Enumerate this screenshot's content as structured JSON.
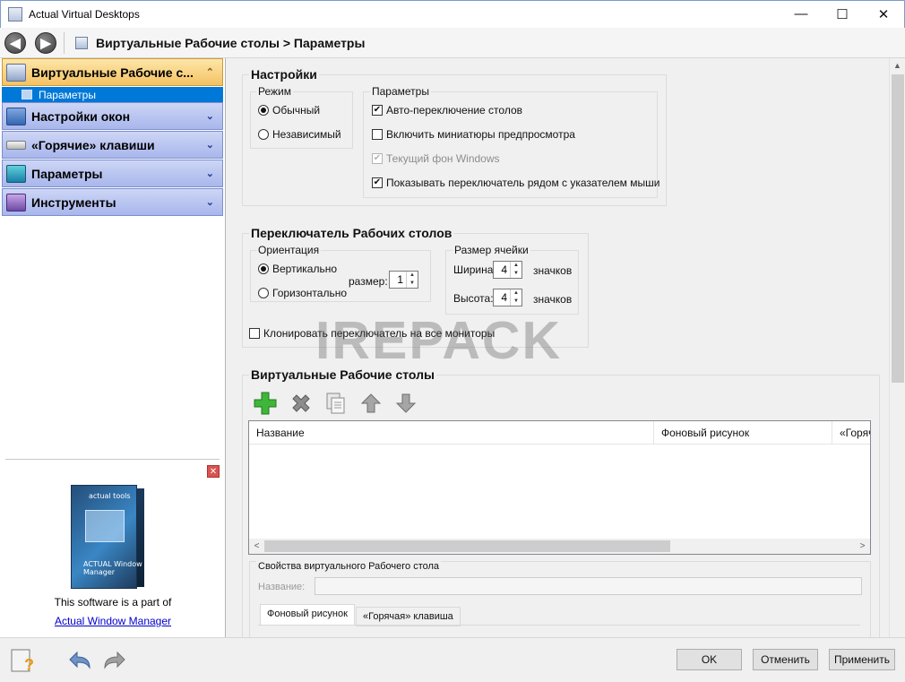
{
  "window": {
    "title": "Actual Virtual Desktops",
    "controls": {
      "minimize": "—",
      "maximize": "☐",
      "close": "✕"
    }
  },
  "nav": {
    "back": "◀",
    "forward": "▶",
    "breadcrumb": "Виртуальные Рабочие столы > Параметры"
  },
  "sidebar": {
    "sections": [
      {
        "label": "Виртуальные Рабочие с...",
        "chevron": "⌃",
        "active": true
      },
      {
        "label": "Настройки окон",
        "chevron": "⌄"
      },
      {
        "label": "«Горячие» клавиши",
        "chevron": "⌄"
      },
      {
        "label": "Параметры",
        "chevron": "⌄"
      },
      {
        "label": "Инструменты",
        "chevron": "⌄"
      }
    ],
    "sub_item": "Параметры",
    "promo": {
      "close": "✕",
      "box_brand": "actual tools",
      "box_product": "ACTUAL Window Manager",
      "text": "This software is a part of",
      "link": "Actual Window Manager"
    }
  },
  "settings": {
    "title": "Настройки",
    "mode": {
      "legend": "Режим",
      "options": [
        "Обычный",
        "Независимый"
      ],
      "selected": 0
    },
    "params": {
      "legend": "Параметры",
      "items": [
        {
          "label": "Авто-переключение столов",
          "checked": true,
          "disabled": false
        },
        {
          "label": "Включить миниатюры предпросмотра",
          "checked": false,
          "disabled": false
        },
        {
          "label": "Текущий фон Windows",
          "checked": true,
          "disabled": true
        },
        {
          "label": "Показывать переключатель рядом с указателем мыши",
          "checked": true,
          "disabled": false
        }
      ]
    }
  },
  "switcher": {
    "title": "Переключатель Рабочих столов",
    "orientation": {
      "legend": "Ориентация",
      "options": [
        "Вертикально",
        "Горизонтально"
      ],
      "selected": 0
    },
    "size_label": "размер:",
    "size_value": "1",
    "cell": {
      "legend": "Размер ячейки",
      "width_label": "Ширина:",
      "width_value": "4",
      "width_unit": "значков",
      "height_label": "Высота:",
      "height_value": "4",
      "height_unit": "значков"
    },
    "clone": {
      "label": "Клонировать переключатель на все мониторы",
      "checked": false
    }
  },
  "desktops": {
    "title": "Виртуальные Рабочие столы",
    "toolbar": [
      "add-icon",
      "delete-icon",
      "copy-icon",
      "move-up-icon",
      "move-down-icon"
    ],
    "columns": [
      "Название",
      "Фоновый рисунок",
      "«Горяч"
    ],
    "scroll_left": "<",
    "scroll_right": ">"
  },
  "properties": {
    "title": "Свойства виртуального Рабочего стола",
    "name_label": "Название:",
    "name_value": "",
    "tabs": [
      "Фоновый рисунок",
      "«Горячая» клавиша"
    ],
    "active_tab": 0
  },
  "watermark": "IREPACK",
  "buttons": {
    "ok": "OK",
    "cancel": "Отменить",
    "apply": "Применить"
  },
  "colors": {
    "selection": "#0078d7",
    "active_header": "#f4c264",
    "header": "#a8b6ec"
  }
}
